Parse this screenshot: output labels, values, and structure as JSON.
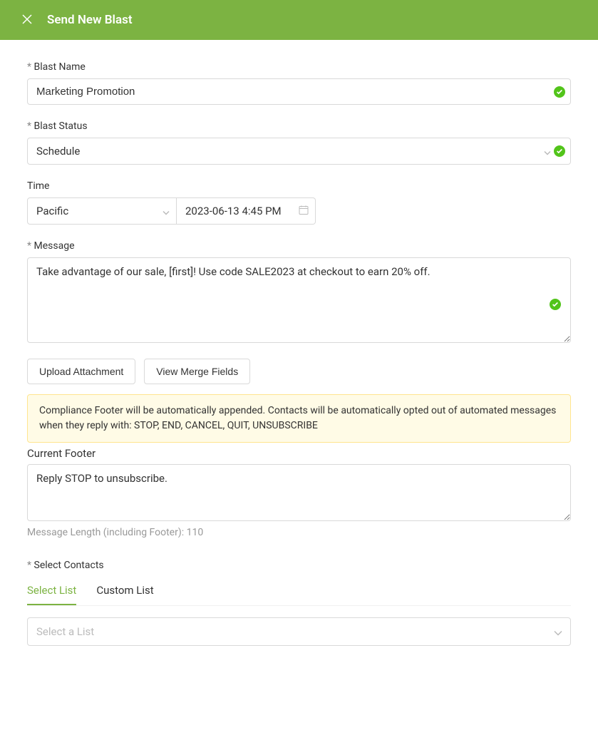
{
  "header": {
    "title": "Send New Blast"
  },
  "form": {
    "blast_name": {
      "label": "Blast Name",
      "value": "Marketing Promotion"
    },
    "blast_status": {
      "label": "Blast Status",
      "value": "Schedule"
    },
    "time": {
      "label": "Time",
      "timezone": "Pacific",
      "datetime": "2023-06-13 4:45 PM"
    },
    "message": {
      "label": "Message",
      "value": "Take advantage of our sale, [first]! Use code SALE2023 at checkout to earn 20% off."
    },
    "buttons": {
      "upload": "Upload Attachment",
      "merge": "View Merge Fields"
    },
    "compliance_notice": "Compliance Footer will be automatically appended. Contacts will be automatically opted out of automated messages when they reply with: STOP, END, CANCEL, QUIT, UNSUBSCRIBE",
    "footer": {
      "label": "Current Footer",
      "value": "Reply STOP to unsubscribe."
    },
    "char_count": "Message Length (including Footer): 110",
    "select_contacts": {
      "label": "Select Contacts",
      "tabs": {
        "select_list": "Select List",
        "custom_list": "Custom List"
      },
      "placeholder": "Select a List"
    }
  }
}
